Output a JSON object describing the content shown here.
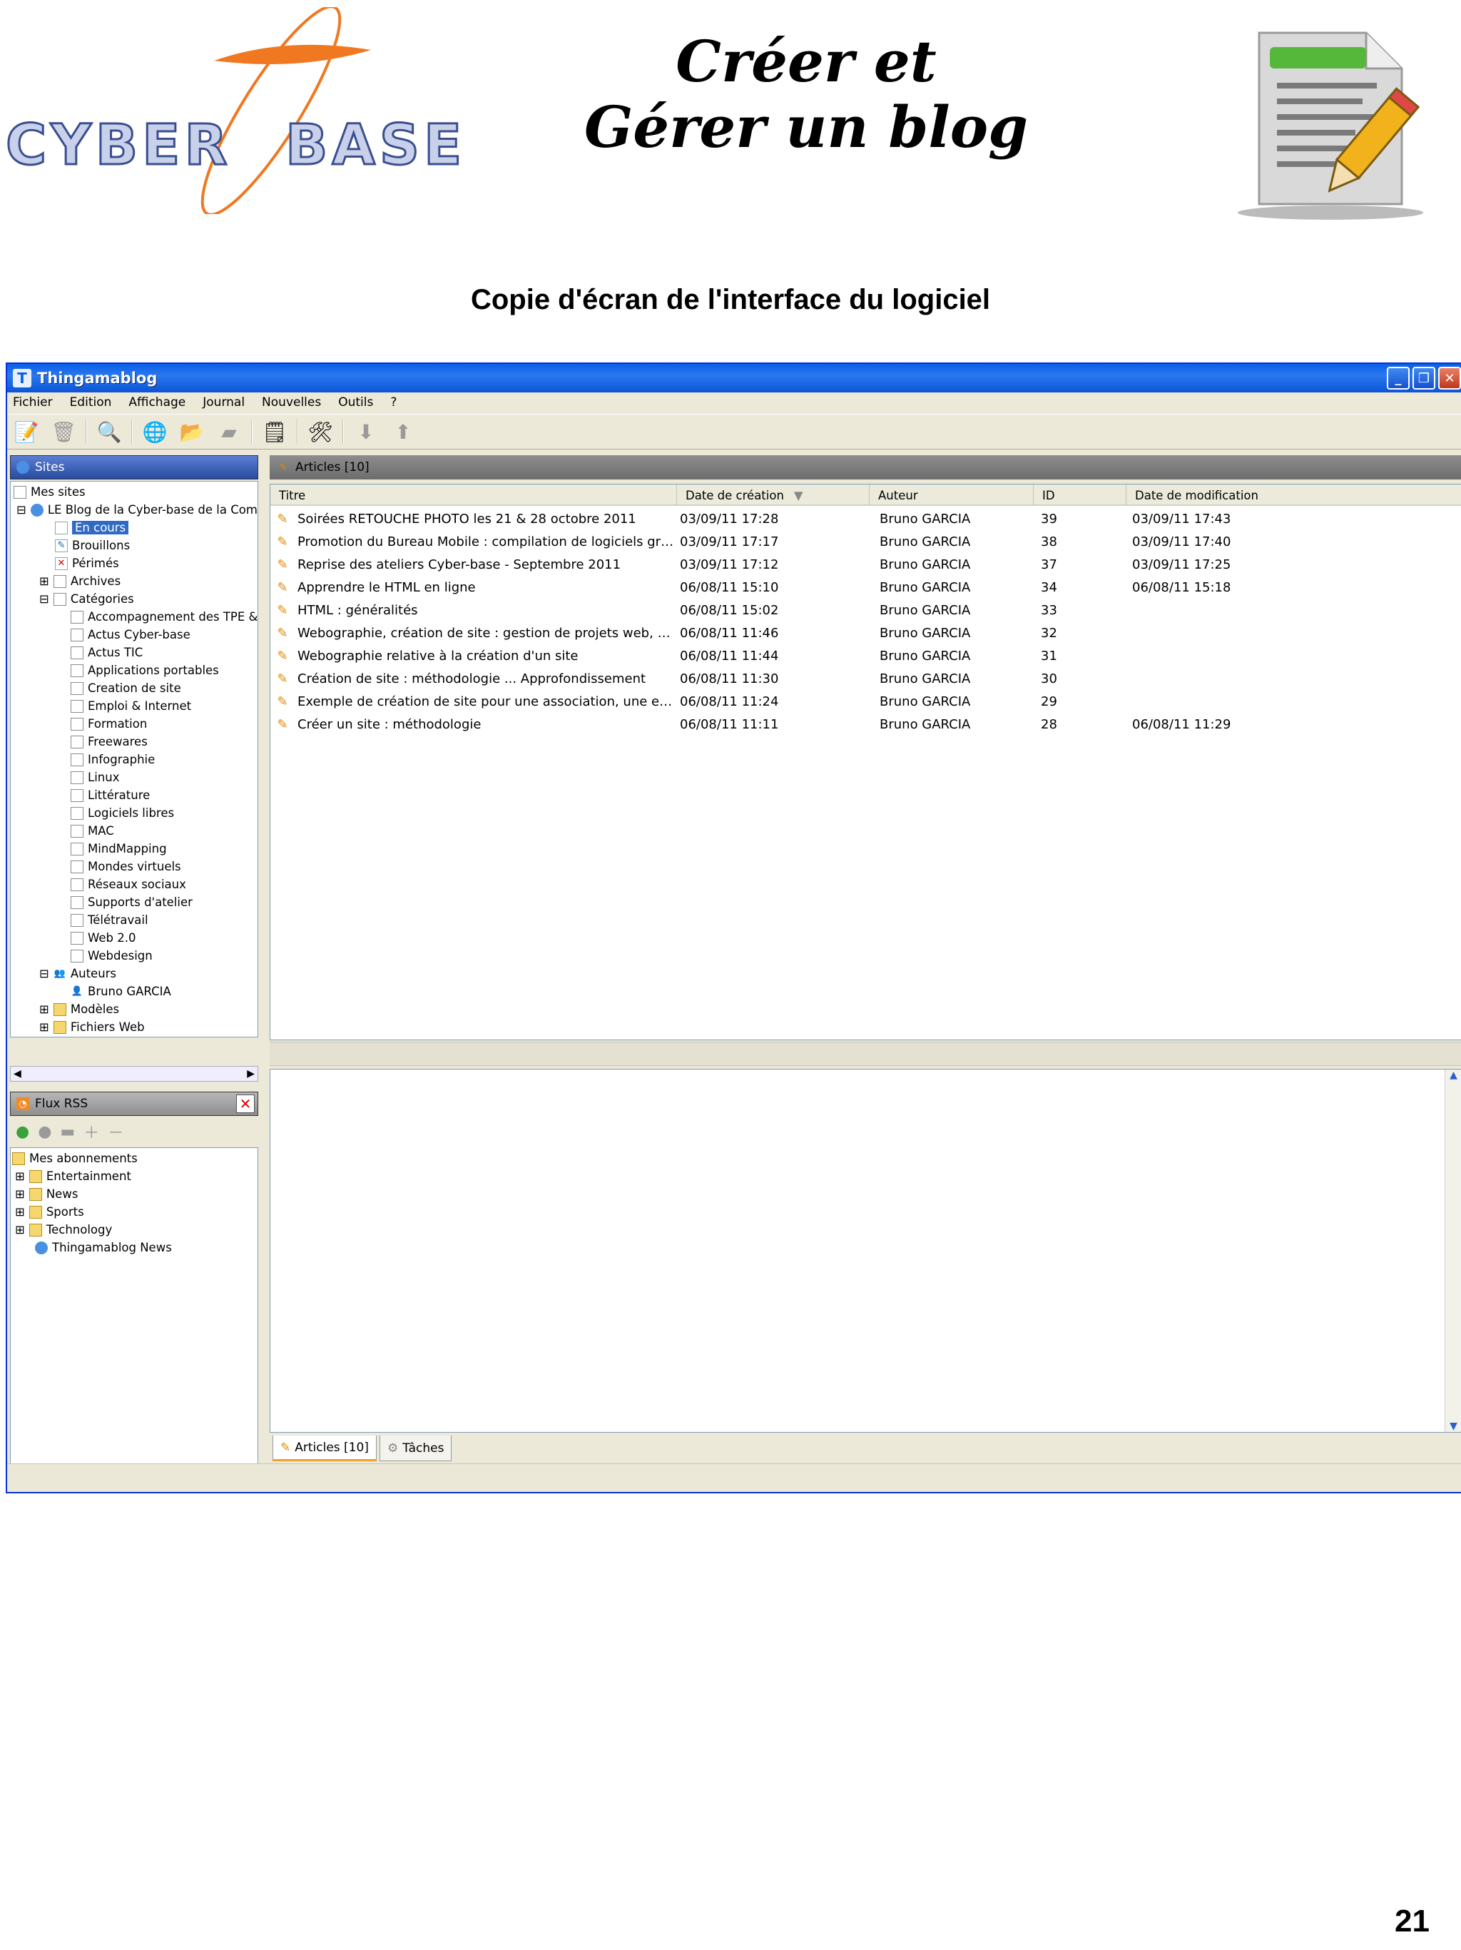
{
  "header": {
    "logo_text": "CYBER BASE",
    "title_line1": "Créer et",
    "title_line2": "Gérer un blog",
    "subtitle": "Copie d'écran de l'interface du logiciel"
  },
  "window": {
    "title": "Thingamablog",
    "menu": [
      "Fichier",
      "Edition",
      "Affichage",
      "Journal",
      "Nouvelles",
      "Outils",
      "?"
    ]
  },
  "sites_panel": {
    "title": "Sites",
    "tree": {
      "root": "Mes sites",
      "blog": "LE Blog de la Cyber-base de la Comm",
      "en_cours": "En cours",
      "brouillons": "Brouillons",
      "perimes": "Périmés",
      "archives": "Archives",
      "categories_label": "Catégories",
      "categories": [
        "Accompagnement des TPE &",
        "Actus Cyber-base",
        "Actus TIC",
        "Applications portables",
        "Creation de site",
        "Emploi & Internet",
        "Formation",
        "Freewares",
        "Infographie",
        "Linux",
        "Littérature",
        "Logiciels libres",
        "MAC",
        "MindMapping",
        "Mondes virtuels",
        "Réseaux sociaux",
        "Supports d'atelier",
        "Télétravail",
        "Web 2.0",
        "Webdesign"
      ],
      "auteurs": "Auteurs",
      "author": "Bruno GARCIA",
      "modeles": "Modèles",
      "fichiers_web": "Fichiers Web"
    }
  },
  "rss_panel": {
    "title": "Flux RSS",
    "root": "Mes abonnements",
    "items": [
      "Entertainment",
      "News",
      "Sports",
      "Technology",
      "Thingamablog News"
    ]
  },
  "articles": {
    "header": "Articles [10]",
    "columns": [
      "Titre",
      "Date de création",
      "Auteur",
      "ID",
      "Date de modification"
    ],
    "rows": [
      {
        "title": "Soirées RETOUCHE PHOTO les 21 & 28 octobre 2011",
        "created": "03/09/11 17:28",
        "author": "Bruno GARCIA",
        "id": "39",
        "modified": "03/09/11 17:43"
      },
      {
        "title": "Promotion du Bureau Mobile : compilation de logiciels gratu...",
        "created": "03/09/11 17:17",
        "author": "Bruno GARCIA",
        "id": "38",
        "modified": "03/09/11 17:40"
      },
      {
        "title": "Reprise des ateliers Cyber-base - Septembre 2011",
        "created": "03/09/11 17:12",
        "author": "Bruno GARCIA",
        "id": "37",
        "modified": "03/09/11 17:25"
      },
      {
        "title": "Apprendre le HTML en ligne",
        "created": "06/08/11 15:10",
        "author": "Bruno GARCIA",
        "id": "34",
        "modified": "06/08/11 15:18"
      },
      {
        "title": "HTML : généralités",
        "created": "06/08/11 15:02",
        "author": "Bruno GARCIA",
        "id": "33",
        "modified": ""
      },
      {
        "title": "Webographie, création de site : gestion de projets web, we...",
        "created": "06/08/11 11:46",
        "author": "Bruno GARCIA",
        "id": "32",
        "modified": ""
      },
      {
        "title": "Webographie relative à la création d'un site",
        "created": "06/08/11 11:44",
        "author": "Bruno GARCIA",
        "id": "31",
        "modified": ""
      },
      {
        "title": "Création de site : méthodologie ... Approfondissement",
        "created": "06/08/11 11:30",
        "author": "Bruno GARCIA",
        "id": "30",
        "modified": ""
      },
      {
        "title": "Exemple de création de site pour une association, une entr...",
        "created": "06/08/11 11:24",
        "author": "Bruno GARCIA",
        "id": "29",
        "modified": ""
      },
      {
        "title": "Créer un site : méthodologie",
        "created": "06/08/11 11:11",
        "author": "Bruno GARCIA",
        "id": "28",
        "modified": "06/08/11 11:29"
      }
    ]
  },
  "tabs": [
    "Articles [10]",
    "Tâches"
  ],
  "page_number": "21",
  "colors": {
    "titlebar": "#0a5fe8",
    "selection": "#316ac5",
    "logo_blue": "#5a6fa6",
    "logo_orange": "#f07820"
  }
}
